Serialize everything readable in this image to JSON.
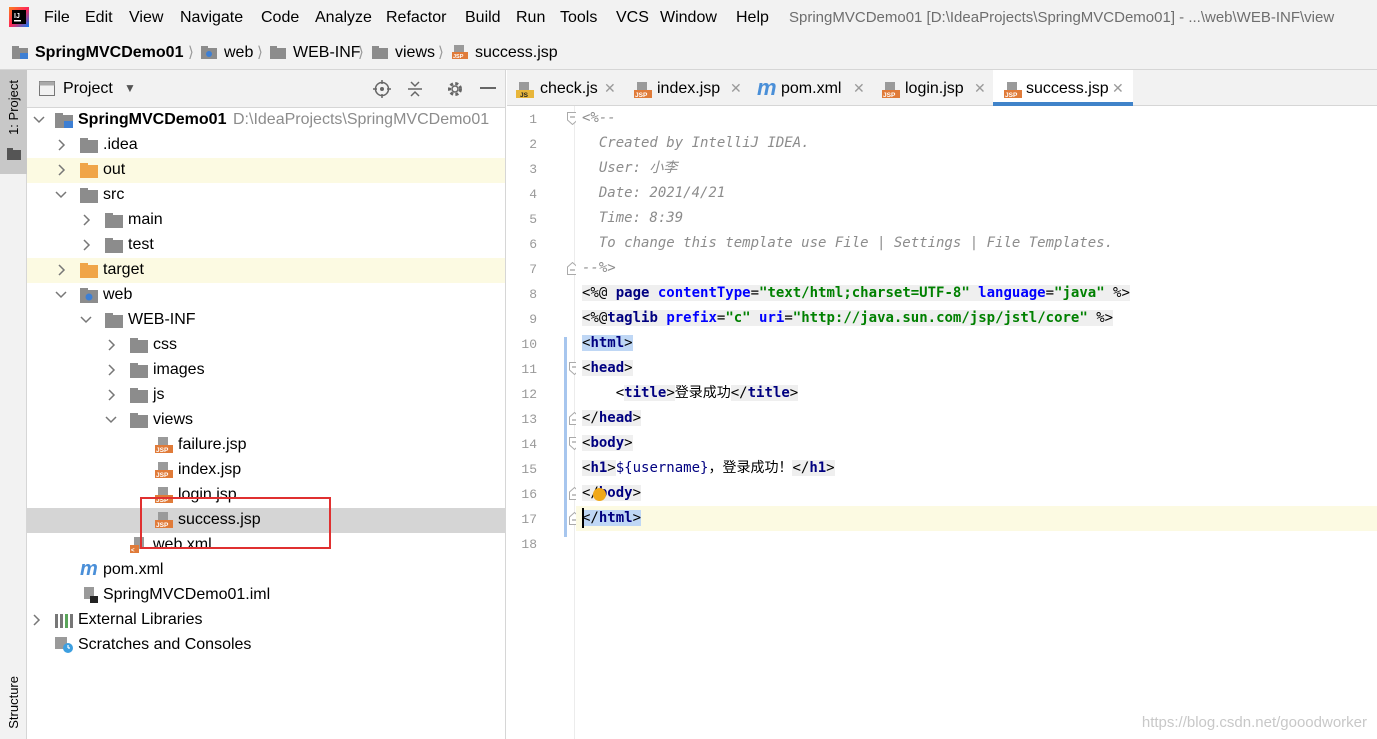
{
  "menubar": {
    "items": [
      "File",
      "Edit",
      "View",
      "Navigate",
      "Code",
      "Analyze",
      "Refactor",
      "Build",
      "Run",
      "Tools",
      "VCS",
      "Window",
      "Help"
    ],
    "window_title": "SpringMVCDemo01 [D:\\IdeaProjects\\SpringMVCDemo01] - ...\\web\\WEB-INF\\view"
  },
  "breadcrumb": [
    "SpringMVCDemo01",
    "web",
    "WEB-INF",
    "views",
    "success.jsp"
  ],
  "left_strip": {
    "project_label": "1: Project",
    "structure_label": "Structure"
  },
  "project_panel": {
    "title": "Project",
    "tree": [
      {
        "label": "SpringMVCDemo01",
        "path": "D:\\IdeaProjects\\SpringMVCDemo01"
      },
      {
        "label": ".idea"
      },
      {
        "label": "out"
      },
      {
        "label": "src"
      },
      {
        "label": "main"
      },
      {
        "label": "test"
      },
      {
        "label": "target"
      },
      {
        "label": "web"
      },
      {
        "label": "WEB-INF"
      },
      {
        "label": "css"
      },
      {
        "label": "images"
      },
      {
        "label": "js"
      },
      {
        "label": "views"
      },
      {
        "label": "failure.jsp"
      },
      {
        "label": "index.jsp"
      },
      {
        "label": "login.jsp"
      },
      {
        "label": "success.jsp"
      },
      {
        "label": "web.xml"
      },
      {
        "label": "pom.xml"
      },
      {
        "label": "SpringMVCDemo01.iml"
      },
      {
        "label": "External Libraries"
      },
      {
        "label": "Scratches and Consoles"
      }
    ]
  },
  "editor": {
    "tabs": [
      "check.js",
      "index.jsp",
      "pom.xml",
      "login.jsp",
      "success.jsp"
    ],
    "active_tab": "success.jsp",
    "line_numbers": [
      "1",
      "2",
      "3",
      "4",
      "5",
      "6",
      "7",
      "8",
      "9",
      "10",
      "11",
      "12",
      "13",
      "14",
      "15",
      "16",
      "17",
      "18"
    ],
    "code": {
      "l1": "<%--",
      "l2": "  Created by IntelliJ IDEA.",
      "l3": "  User: 小李",
      "l4": "  Date: 2021/4/21",
      "l5": "  Time: 8:39",
      "l6": "  To change this template use File | Settings | File Templates.",
      "l7": "--%>",
      "l8_a": "<%@ ",
      "l8_b": "page ",
      "l8_c": "contentType",
      "l8_d": "=",
      "l8_e": "\"text/html;charset=UTF-8\"",
      "l8_f": " language",
      "l8_g": "=",
      "l8_h": "\"java\"",
      "l8_i": " %>",
      "l9_a": "<%@",
      "l9_b": "taglib ",
      "l9_c": "prefix",
      "l9_d": "=",
      "l9_e": "\"c\"",
      "l9_f": " uri",
      "l9_g": "=",
      "l9_h": "\"http://java.sun.com/jsp/jstl/core\"",
      "l9_i": " %>",
      "l10_a": "<",
      "l10_b": "html",
      "l10_c": ">",
      "l11_a": "<",
      "l11_b": "head",
      "l11_c": ">",
      "l12_a": "    <",
      "l12_b": "title",
      "l12_c": ">",
      "l12_d": "登录成功",
      "l12_e": "</",
      "l12_f": "title",
      "l12_g": ">",
      "l13_a": "</",
      "l13_b": "head",
      "l13_c": ">",
      "l14_a": "<",
      "l14_b": "body",
      "l14_c": ">",
      "l15_a": "<",
      "l15_b": "h1",
      "l15_c": ">",
      "l15_d": "${username}",
      "l15_e": "，登录成功！",
      "l15_f": "</",
      "l15_g": "h1",
      "l15_h": ">",
      "l16_a": "</",
      "l16_b": "body",
      "l16_c": ">",
      "l17_a": "</",
      "l17_b": "html",
      "l17_c": ">"
    }
  },
  "watermark": "https://blog.csdn.net/gooodworker",
  "colors": {
    "accent": "#4083c9",
    "highlight_box": "#e03030",
    "excluded_row": "#fcfae2",
    "selected_row": "#d5d5d5"
  }
}
